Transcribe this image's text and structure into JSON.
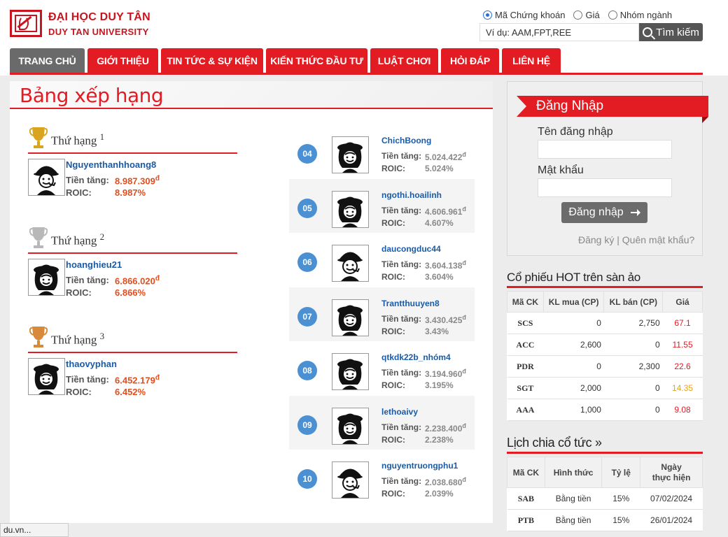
{
  "header": {
    "uni_name_vi": "ĐẠI HỌC DUY TÂN",
    "uni_name_en": "DUY TAN UNIVERSITY",
    "search_modes": [
      "Mã Chứng khoán",
      "Giá",
      "Nhóm ngành"
    ],
    "search_mode_selected": "Mã Chứng khoán",
    "search_value": "Ví dụ: AAM,FPT,REE",
    "search_button": "Tìm kiếm"
  },
  "nav": [
    "TRANG CHỦ",
    "GIỚI THIỆU",
    "TIN TỨC & SỰ KIỆN",
    "KIẾN THỨC ĐẦU TƯ",
    "LUẬT CHƠI",
    "HỎI ĐÁP",
    "LIÊN HỆ"
  ],
  "leaderboard": {
    "title": "Bảng xếp hạng",
    "rank_label": "Thứ hạng",
    "gain_label": "Tiền tăng:",
    "roic_label": "ROIC:",
    "currency": "đ",
    "top3": [
      {
        "rank": "1",
        "user": "Nguyenthanhhoang8",
        "gain": "8.987.309",
        "roic": "8.987%",
        "avatar": "man-hat-pipe"
      },
      {
        "rank": "2",
        "user": "hoanghieu21",
        "gain": "6.866.020",
        "roic": "6.866%",
        "avatar": "woman-hat"
      },
      {
        "rank": "3",
        "user": "thaovyphan",
        "gain": "6.452.179",
        "roic": "6.452%",
        "avatar": "woman-hat"
      }
    ],
    "others": [
      {
        "rank": "04",
        "user": "ChichBoong",
        "gain": "5.024.422",
        "roic": "5.024%",
        "avatar": "woman-hat"
      },
      {
        "rank": "05",
        "user": "ngothi.hoailinh",
        "gain": "4.606.961",
        "roic": "4.607%",
        "avatar": "woman-hat"
      },
      {
        "rank": "06",
        "user": "daucongduc44",
        "gain": "3.604.138",
        "roic": "3.604%",
        "avatar": "man-hat-pipe"
      },
      {
        "rank": "07",
        "user": "Trantthuuyen8",
        "gain": "3.430.425",
        "roic": "3.43%",
        "avatar": "woman-hat"
      },
      {
        "rank": "08",
        "user": "qtkdk22b_nhóm4",
        "gain": "3.194.960",
        "roic": "3.195%",
        "avatar": "woman-hat"
      },
      {
        "rank": "09",
        "user": "lethoaivy",
        "gain": "2.238.400",
        "roic": "2.238%",
        "avatar": "woman-hat"
      },
      {
        "rank": "10",
        "user": "nguyentruongphu1",
        "gain": "2.038.680",
        "roic": "2.039%",
        "avatar": "man-hat-pipe"
      }
    ],
    "trophy_colors": {
      "gold": "#d9a521",
      "silver": "#b8b8b8",
      "bronze": "#d8893a"
    }
  },
  "login": {
    "title": "Đăng Nhập",
    "username_label": "Tên đăng nhập",
    "password_label": "Mật khẩu",
    "username_value": "",
    "submit": "Đăng nhập",
    "register": "Đăng ký",
    "separator": "|",
    "forgot": "Quên mật khẩu?"
  },
  "hot_stocks": {
    "title": "Cổ phiếu HOT trên sàn ảo",
    "headers": [
      "Mã CK",
      "KL mua (CP)",
      "KL bán (CP)",
      "Giá"
    ],
    "rows": [
      {
        "code": "SCS",
        "buy": "0",
        "sell": "2,750",
        "price": "67.1",
        "color": "#e31b23"
      },
      {
        "code": "ACC",
        "buy": "2,600",
        "sell": "0",
        "price": "11.55",
        "color": "#e31b23"
      },
      {
        "code": "PDR",
        "buy": "0",
        "sell": "2,300",
        "price": "22.6",
        "color": "#e31b23"
      },
      {
        "code": "SGT",
        "buy": "2,000",
        "sell": "0",
        "price": "14.35",
        "color": "#e8a317"
      },
      {
        "code": "AAA",
        "buy": "1,000",
        "sell": "0",
        "price": "9.08",
        "color": "#e31b23"
      }
    ]
  },
  "dividends": {
    "title": "Lịch chia cổ tức »",
    "headers": [
      "Mã CK",
      "Hình thức",
      "Tỷ lệ",
      "Ngày\nthực hiện"
    ],
    "rows": [
      {
        "code": "SAB",
        "form": "Bằng tiền",
        "ratio": "15%",
        "date": "07/02/2024"
      },
      {
        "code": "PTB",
        "form": "Bằng tiền",
        "ratio": "15%",
        "date": "26/01/2024"
      }
    ]
  },
  "status_bar": "du.vn..."
}
